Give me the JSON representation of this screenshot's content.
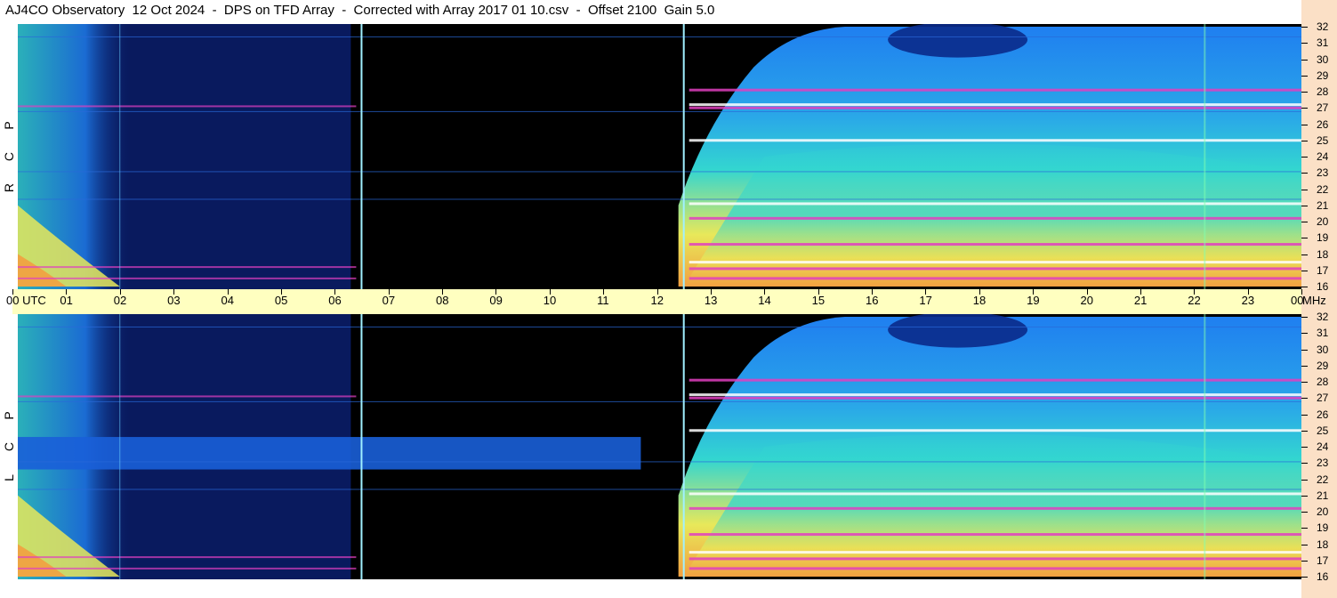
{
  "header": {
    "title": "AJ4CO Observatory  12 Oct 2024  -  DPS on TFD Array  -  Corrected with Array 2017 01 10.csv  -  Offset 2100  Gain 5.0"
  },
  "panels": [
    {
      "name": "RCP",
      "letters": [
        "P",
        "C",
        "R"
      ]
    },
    {
      "name": "LCP",
      "letters": [
        "P",
        "C",
        "L"
      ]
    }
  ],
  "time_axis": {
    "labels": [
      "00  UTC",
      "01",
      "02",
      "03",
      "04",
      "05",
      "06",
      "07",
      "08",
      "09",
      "10",
      "11",
      "12",
      "13",
      "14",
      "15",
      "16",
      "17",
      "18",
      "19",
      "20",
      "21",
      "22",
      "23",
      "00"
    ],
    "unit": "MHz"
  },
  "freq_axis": {
    "labels": [
      "32",
      "31",
      "30",
      "29",
      "28",
      "27",
      "26",
      "25",
      "24",
      "23",
      "22",
      "21",
      "20",
      "19",
      "18",
      "17",
      "16"
    ]
  },
  "colors": {
    "background": "#000000",
    "low": "#0a1f6e",
    "mid": "#1f7ff0",
    "cyan": "#33d6d0",
    "yellow": "#e8e85a",
    "orange": "#f2a040",
    "magenta": "#e040c0",
    "time_band": "#ffffc0",
    "freq_band": "#fbe0c6"
  },
  "chart_data": {
    "type": "heatmap",
    "title": "AJ4CO Observatory  12 Oct 2024  -  DPS on TFD Array  -  Corrected with Array 2017 01 10.csv  -  Offset 2100  Gain 5.0",
    "x": {
      "unit": "UTC",
      "range": [
        0,
        24
      ],
      "ticks": [
        0,
        1,
        2,
        3,
        4,
        5,
        6,
        7,
        8,
        9,
        10,
        11,
        12,
        13,
        14,
        15,
        16,
        17,
        18,
        19,
        20,
        21,
        22,
        23,
        24
      ]
    },
    "y": {
      "unit": "MHz",
      "range": [
        16,
        32
      ],
      "ticks": [
        16,
        17,
        18,
        19,
        20,
        21,
        22,
        23,
        24,
        25,
        26,
        27,
        28,
        29,
        30,
        31,
        32
      ]
    },
    "series": [
      {
        "name": "RCP",
        "description_regions": [
          {
            "x": [
              0,
              2
            ],
            "y": [
              16,
              20
            ],
            "level": "high"
          },
          {
            "x": [
              2,
              12.4
            ],
            "y": [
              16,
              32
            ],
            "level": "low"
          },
          {
            "x": [
              12.4,
              24
            ],
            "y": [
              16,
              24
            ],
            "level": "high"
          },
          {
            "x": [
              12.4,
              24
            ],
            "y": [
              24,
              32
            ],
            "level": "medium"
          }
        ]
      },
      {
        "name": "LCP",
        "description_regions": [
          {
            "x": [
              0,
              2
            ],
            "y": [
              16,
              20
            ],
            "level": "high"
          },
          {
            "x": [
              0,
              11.7
            ],
            "y": [
              22.5,
              24.5
            ],
            "level": "medium"
          },
          {
            "x": [
              12.4,
              24
            ],
            "y": [
              16,
              24
            ],
            "level": "high"
          },
          {
            "x": [
              12.4,
              24
            ],
            "y": [
              24,
              32
            ],
            "level": "medium"
          }
        ]
      }
    ],
    "vertical_lines_utc": [
      6.5,
      12.5
    ]
  }
}
